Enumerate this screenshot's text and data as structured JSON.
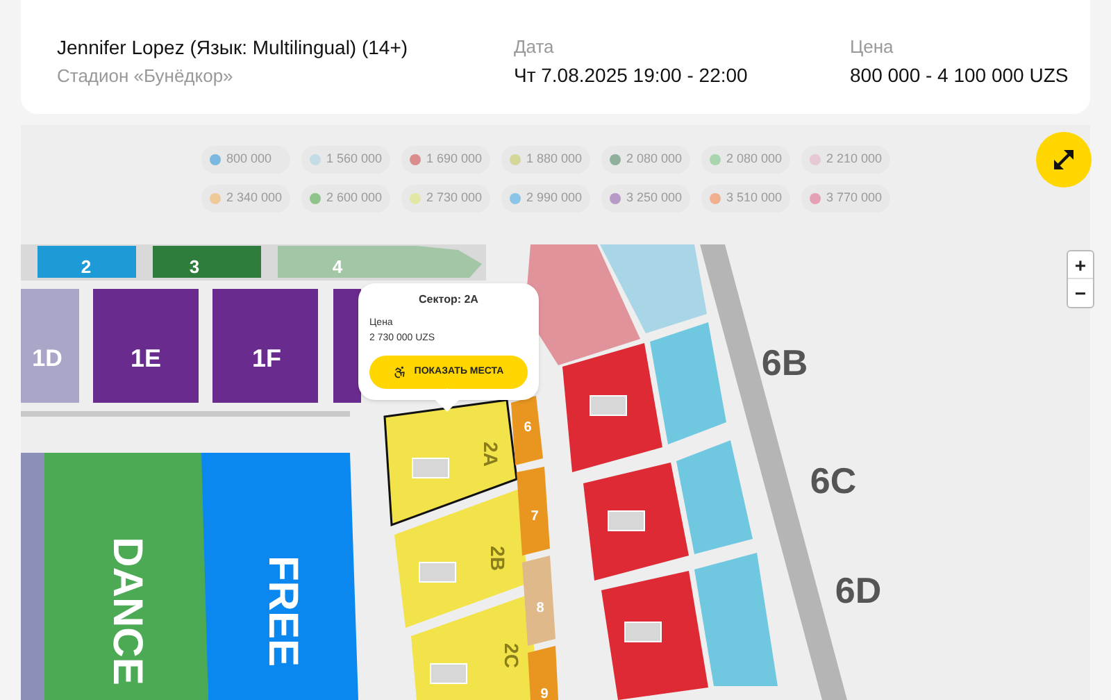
{
  "event": {
    "title": "Jennifer Lopez (Язык: Multilingual) (14+)",
    "venue": "Стадион «Бунёдкор»"
  },
  "date": {
    "label": "Дата",
    "value": "Чт 7.08.2025 19:00 - 22:00"
  },
  "price": {
    "label": "Цена",
    "value": "800 000 - 4 100 000 UZS"
  },
  "legend": [
    {
      "price": "800 000",
      "color": "#7ab8e0"
    },
    {
      "price": "1 560 000",
      "color": "#c3dce6"
    },
    {
      "price": "1 690 000",
      "color": "#d98d8d"
    },
    {
      "price": "1 880 000",
      "color": "#d4d69a"
    },
    {
      "price": "2 080 000",
      "color": "#8fb09a"
    },
    {
      "price": "2 080 000",
      "color": "#a8d4ae"
    },
    {
      "price": "2 210 000",
      "color": "#e6c8d5"
    },
    {
      "price": "2 340 000",
      "color": "#f0c99a"
    },
    {
      "price": "2 600 000",
      "color": "#8fc48a"
    },
    {
      "price": "2 730 000",
      "color": "#e2e8a4"
    },
    {
      "price": "2 990 000",
      "color": "#8ac4e6"
    },
    {
      "price": "3 250 000",
      "color": "#b79ac6"
    },
    {
      "price": "3 510 000",
      "color": "#f0b090"
    },
    {
      "price": "3 770 000",
      "color": "#e6a0b4"
    }
  ],
  "map": {
    "sectors": [
      {
        "label": "2",
        "color": "#1e9ad6",
        "selected": false
      },
      {
        "label": "3",
        "color": "#2f7d3c",
        "selected": false
      },
      {
        "label": "4",
        "color": "#a3c6a6",
        "selected": false
      },
      {
        "label": "1D",
        "color": "#a9a6c8",
        "selected": false
      },
      {
        "label": "1E",
        "color": "#6a2b8e",
        "selected": false
      },
      {
        "label": "1F",
        "color": "#6a2b8e",
        "selected": false
      },
      {
        "label": "DANCE",
        "color": "#4caa55",
        "selected": false
      },
      {
        "label": "FREE",
        "color": "#0b88f0",
        "selected": false
      },
      {
        "label": "2A",
        "color": "#f2e34a",
        "selected": true
      },
      {
        "label": "2B",
        "color": "#f2e34a",
        "selected": false
      },
      {
        "label": "2C",
        "color": "#f2e34a",
        "selected": false
      },
      {
        "label": "6",
        "color": "#e8961f",
        "selected": false
      },
      {
        "label": "7",
        "color": "#e8961f",
        "selected": false
      },
      {
        "label": "8",
        "color": "#dfb98a",
        "selected": false
      },
      {
        "label": "9",
        "color": "#e8961f",
        "selected": false
      },
      {
        "label": "6B",
        "color": "#dd2a35",
        "selected": false
      },
      {
        "label": "6C",
        "color": "#dd2a35",
        "selected": false
      },
      {
        "label": "6D",
        "color": "#dd2a35",
        "selected": false
      }
    ],
    "tooltip": {
      "sector": "Сектор: 2A",
      "price_label": "Цена",
      "price_value": "2 730 000 UZS",
      "button": "ПОКАЗАТЬ МЕСТА"
    },
    "zoom": [
      "+",
      "−"
    ]
  }
}
